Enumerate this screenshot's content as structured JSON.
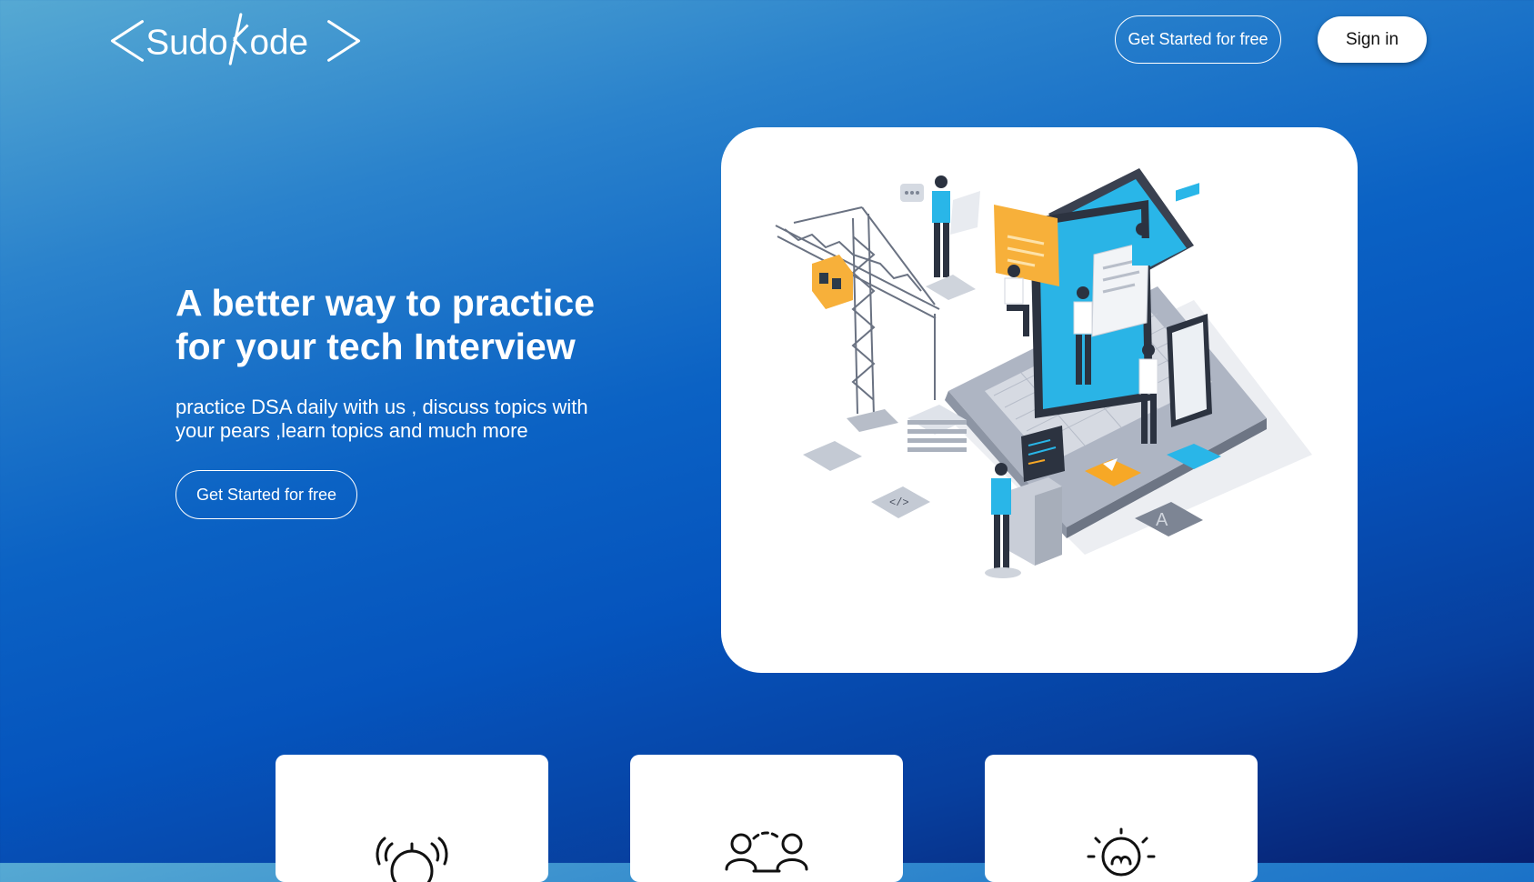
{
  "header": {
    "logo": {
      "text": "<Sudokode>",
      "alt": "SudoKode"
    },
    "get_started_label": "Get Started for free",
    "signin_label": "Sign in"
  },
  "hero": {
    "headline": "A better way to practice for your tech Interview",
    "subtitle": "practice DSA daily with us , discuss topics with your pears ,learn topics and much more",
    "cta_label": "Get Started for free",
    "illustration": "isometric-laptop-team-crane"
  },
  "features": [
    {
      "icon": "alarm-clock-icon"
    },
    {
      "icon": "people-discussion-icon"
    },
    {
      "icon": "idea-lightbulb-icon"
    }
  ],
  "colors": {
    "bg_top": "#56a9d3",
    "bg_mid": "#0554bd",
    "bg_bottom": "#071f6e",
    "accent_cyan": "#29b6e8",
    "accent_orange": "#f7a826"
  }
}
